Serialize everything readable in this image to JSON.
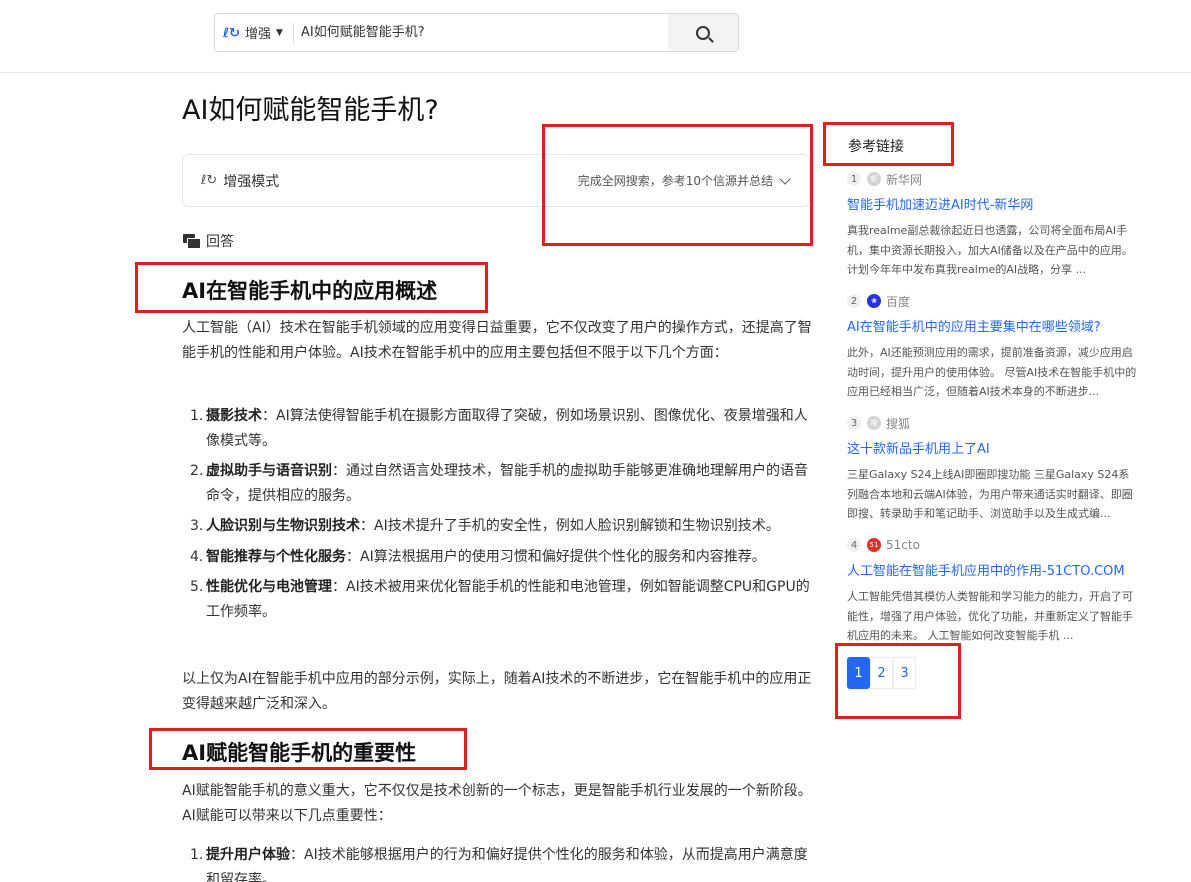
{
  "search": {
    "mode_label": "增强",
    "query": "AI如何赋能智能手机?"
  },
  "page_title": "AI如何赋能智能手机?",
  "mode_card": {
    "label": "增强模式",
    "status": "完成全网搜索，参考10个信源并总结"
  },
  "answer_label": "回答",
  "sections": [
    {
      "heading": "AI在智能手机中的应用概述",
      "intro": "人工智能（AI）技术在智能手机领域的应用变得日益重要，它不仅改变了用户的操作方式，还提高了智能手机的性能和用户体验。AI技术在智能手机中的应用主要包括但不限于以下几个方面：",
      "items": [
        {
          "num": "1.",
          "term": "摄影技术",
          "text": "：AI算法使得智能手机在摄影方面取得了突破，例如场景识别、图像优化、夜景增强和人像模式等。"
        },
        {
          "num": "2.",
          "term": "虚拟助手与语音识别",
          "text": "：通过自然语言处理技术，智能手机的虚拟助手能够更准确地理解用户的语音命令，提供相应的服务。"
        },
        {
          "num": "3.",
          "term": "人脸识别与生物识别技术",
          "text": "：AI技术提升了手机的安全性，例如人脸识别解锁和生物识别技术。"
        },
        {
          "num": "4.",
          "term": "智能推荐与个性化服务",
          "text": "：AI算法根据用户的使用习惯和偏好提供个性化的服务和内容推荐。"
        },
        {
          "num": "5.",
          "term": "性能优化与电池管理",
          "text": "：AI技术被用来优化智能手机的性能和电池管理，例如智能调整CPU和GPU的工作频率。"
        }
      ],
      "outro": "以上仅为AI在智能手机中应用的部分示例，实际上，随着AI技术的不断进步，它在智能手机中的应用正变得越来越广泛和深入。"
    },
    {
      "heading": "AI赋能智能手机的重要性",
      "intro": "AI赋能智能手机的意义重大，它不仅仅是技术创新的一个标志，更是智能手机行业发展的一个新阶段。AI赋能可以带来以下几点重要性：",
      "items": [
        {
          "num": "1.",
          "term": "提升用户体验",
          "text": "：AI技术能够根据用户的行为和偏好提供个性化的服务和体验，从而提高用户满意度和留存率。"
        }
      ]
    }
  ],
  "sidebar": {
    "title": "参考链接",
    "refs": [
      {
        "idx": "1",
        "source": "新华网",
        "icon": "xinhua-icon",
        "icon_color": "#cccccc",
        "title": "智能手机加速迈进AI时代-新华网",
        "snippet": "真我realme副总裁徐起近日也透露，公司将全面布局AI手机，集中资源长期投入，加大AI储备以及在产品中的应用。计划今年年中发布真我realme的AI战略，分享 ..."
      },
      {
        "idx": "2",
        "source": "百度",
        "icon": "baidu-paw-icon",
        "icon_color": "#2932e1",
        "title": "AI在智能手机中的应用主要集中在哪些领域?",
        "snippet": "此外，AI还能预测应用的需求，提前准备资源，减少应用启动时间，提升用户的使用体验。 尽管AI技术在智能手机中的应用已经相当广泛，但随着AI技术本身的不断进步..."
      },
      {
        "idx": "3",
        "source": "搜狐",
        "icon": "sohu-icon",
        "icon_color": "#cccccc",
        "title": "这十款新品手机用上了AI",
        "snippet": "三星Galaxy S24上线AI即圈即搜功能 三星Galaxy S24系列融合本地和云端AI体验，为用户带来通话实时翻译、即圈即搜、转录助手和笔记助手、浏览助手以及生成式编..."
      },
      {
        "idx": "4",
        "source": "51cto",
        "icon": "51cto-icon",
        "icon_color": "#d9332a",
        "title": "人工智能在智能手机应用中的作用-51CTO.COM",
        "snippet": "人工智能凭借其模仿人类智能和学习能力的能力，开启了可能性，增强了用户体验，优化了功能，并重新定义了智能手机应用的未来。 人工智能如何改变智能手机 ..."
      }
    ],
    "pages": [
      "1",
      "2",
      "3"
    ],
    "active_page": "1"
  },
  "colors": {
    "accent": "#2468f2",
    "annotation_red": "#e02020"
  }
}
